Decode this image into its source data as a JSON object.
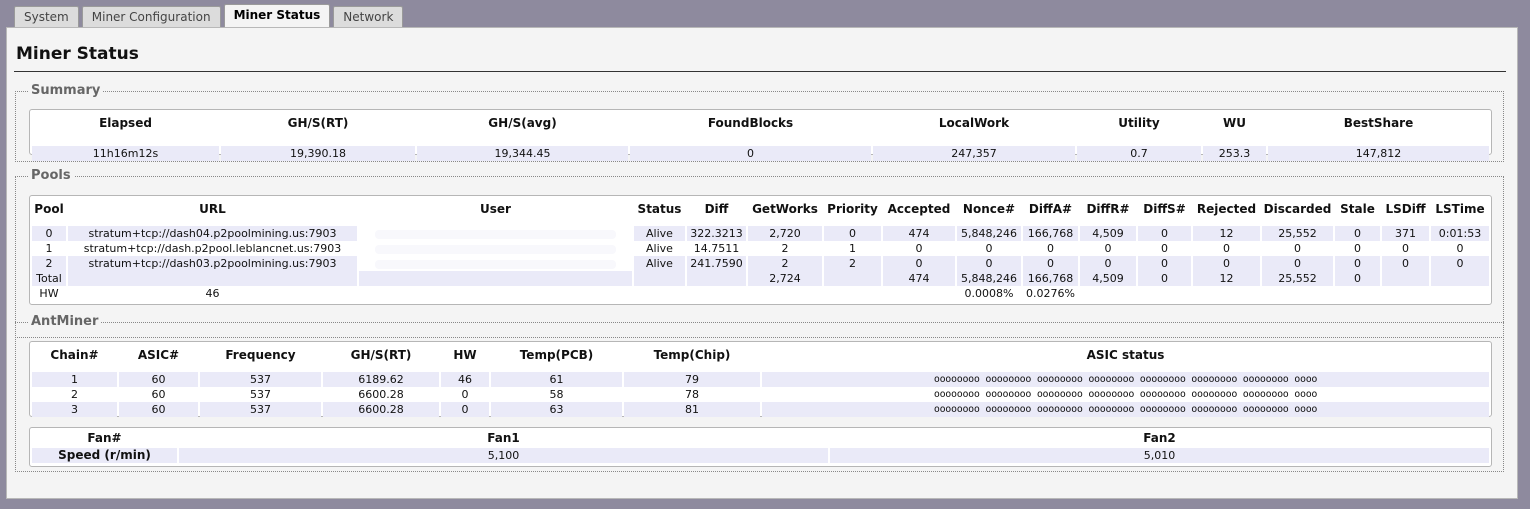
{
  "tabs": [
    "System",
    "Miner Configuration",
    "Miner Status",
    "Network"
  ],
  "active_tab": "Miner Status",
  "page_title": "Miner Status",
  "summary": {
    "legend": "Summary",
    "headers": [
      "Elapsed",
      "GH/S(RT)",
      "GH/S(avg)",
      "FoundBlocks",
      "LocalWork",
      "Utility",
      "WU",
      "BestShare"
    ],
    "values": [
      "11h16m12s",
      "19,390.18",
      "19,344.45",
      "0",
      "247,357",
      "0.7",
      "253.3",
      "147,812"
    ]
  },
  "pools": {
    "legend": "Pools",
    "headers": [
      "Pool",
      "URL",
      "User",
      "Status",
      "Diff",
      "GetWorks",
      "Priority",
      "Accepted",
      "Nonce#",
      "DiffA#",
      "DiffR#",
      "DiffS#",
      "Rejected",
      "Discarded",
      "Stale",
      "LSDiff",
      "LSTime"
    ],
    "rows": [
      [
        "0",
        "stratum+tcp://dash04.p2poolmining.us:7903",
        "",
        "Alive",
        "322.3213",
        "2,720",
        "0",
        "474",
        "5,848,246",
        "166,768",
        "4,509",
        "0",
        "12",
        "25,552",
        "0",
        "371",
        "0:01:53"
      ],
      [
        "1",
        "stratum+tcp://dash.p2pool.leblancnet.us:7903",
        "",
        "Alive",
        "14.7511",
        "2",
        "1",
        "0",
        "0",
        "0",
        "0",
        "0",
        "0",
        "0",
        "0",
        "0",
        "0"
      ],
      [
        "2",
        "stratum+tcp://dash03.p2poolmining.us:7903",
        "",
        "Alive",
        "241.7590",
        "2",
        "2",
        "0",
        "0",
        "0",
        "0",
        "0",
        "0",
        "0",
        "0",
        "0",
        "0"
      ]
    ],
    "total": [
      "Total",
      "",
      "",
      "",
      "",
      "2,724",
      "",
      "474",
      "5,848,246",
      "166,768",
      "4,509",
      "0",
      "12",
      "25,552",
      "0",
      "",
      ""
    ],
    "hw": [
      "HW",
      "46",
      "",
      "",
      "",
      "",
      "",
      "",
      "0.0008%",
      "0.0276%",
      "",
      "",
      "",
      "",
      "",
      "",
      ""
    ]
  },
  "antminer": {
    "legend": "AntMiner",
    "headers": [
      "Chain#",
      "ASIC#",
      "Frequency",
      "GH/S(RT)",
      "HW",
      "Temp(PCB)",
      "Temp(Chip)",
      "ASIC status"
    ],
    "rows": [
      [
        "1",
        "60",
        "537",
        "6189.62",
        "46",
        "61",
        "79",
        "oooooooo oooooooo oooooooo oooooooo oooooooo oooooooo oooooooo oooo"
      ],
      [
        "2",
        "60",
        "537",
        "6600.28",
        "0",
        "58",
        "78",
        "oooooooo oooooooo oooooooo oooooooo oooooooo oooooooo oooooooo oooo"
      ],
      [
        "3",
        "60",
        "537",
        "6600.28",
        "0",
        "63",
        "81",
        "oooooooo oooooooo oooooooo oooooooo oooooooo oooooooo oooooooo oooo"
      ]
    ],
    "fans": {
      "headers": [
        "Fan#",
        "Fan1",
        "Fan2"
      ],
      "values": [
        "Speed (r/min)",
        "5,100",
        "5,010"
      ]
    }
  },
  "colors": {
    "background": "#8e8a9e",
    "panel": "#f4f4f4",
    "row_shade": "#eaeaf8"
  }
}
